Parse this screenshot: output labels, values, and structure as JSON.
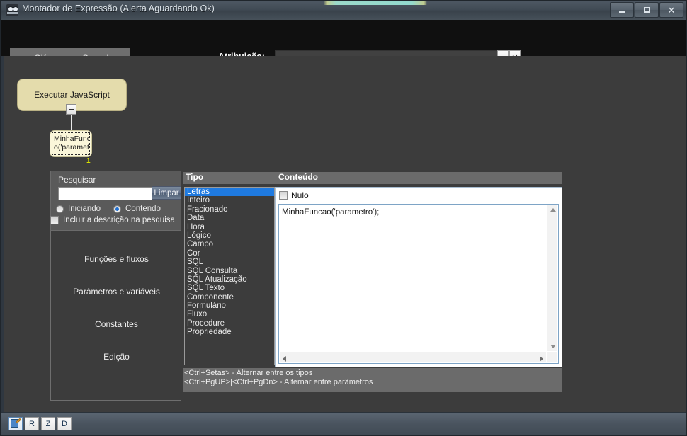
{
  "window": {
    "title": "Montador de Expressão (Alerta Aguardando Ok)",
    "icon": "binoculars-icon",
    "minimize": "–",
    "maximize": "□",
    "close": "✕"
  },
  "toolbar": {
    "ok_label": "OK",
    "cancel_label": "Cancelar",
    "atribuicao_label": "Atribuição:",
    "atribuicao_value": "",
    "atribuicao_placeholder": "",
    "dropdown_icon": "▼",
    "clear_icon": "✕"
  },
  "flow": {
    "main_node": "Executar JavaScript",
    "collapse_icon": "−",
    "sub_node_line1": "MinhaFunca",
    "sub_node_line2": "o('parametr",
    "sub_node_number": "1"
  },
  "search": {
    "label": "Pesquisar",
    "value": "",
    "placeholder": "",
    "clear_button": "Limpar",
    "radio_iniciando": "Iniciando",
    "radio_contendo": "Contendo",
    "selected_radio": "Contendo",
    "checkbox_descricao": "Incluir a descrição na pesquisa",
    "checkbox_checked": false
  },
  "categories": [
    {
      "label": "Funções e fluxos"
    },
    {
      "label": "Parâmetros e variáveis"
    },
    {
      "label": "Constantes"
    },
    {
      "label": "Edição"
    }
  ],
  "tipo": {
    "header": "Tipo",
    "selected": "Letras",
    "items": [
      "Letras",
      "Inteiro",
      "Fracionado",
      "Data",
      "Hora",
      "Lógico",
      "Campo",
      "Cor",
      "SQL",
      "SQL Consulta",
      "SQL Atualização",
      "SQL Texto",
      "Componente",
      "Formulário",
      "Fluxo",
      "Procedure",
      "Propriedade"
    ]
  },
  "conteudo": {
    "header": "Conteúdo",
    "nulo_label": "Nulo",
    "nulo_checked": false,
    "editor_text": "MinhaFuncao('parametro');",
    "scroll_up_icon": "▲",
    "scroll_down_icon": "▼",
    "scroll_left_icon": "◀",
    "scroll_right_icon": "▶"
  },
  "hints": {
    "line1": "<Ctrl+Setas> - Alternar entre os tipos",
    "line2": "<Ctrl+PgUP>|<Ctrl+PgDn> - Alternar entre parâmetros"
  },
  "statusbar": {
    "buttons": [
      {
        "label": "",
        "icon": "edit-pencil-icon",
        "active": true
      },
      {
        "label": "R",
        "icon": "",
        "active": false
      },
      {
        "label": "Z",
        "icon": "",
        "active": false
      },
      {
        "label": "D",
        "icon": "",
        "active": false
      }
    ]
  },
  "colors": {
    "accent_selection": "#1f7ae0",
    "node_fill": "#e4dcac",
    "node_number": "#d7e000",
    "title_glow": "#96e2d4"
  }
}
